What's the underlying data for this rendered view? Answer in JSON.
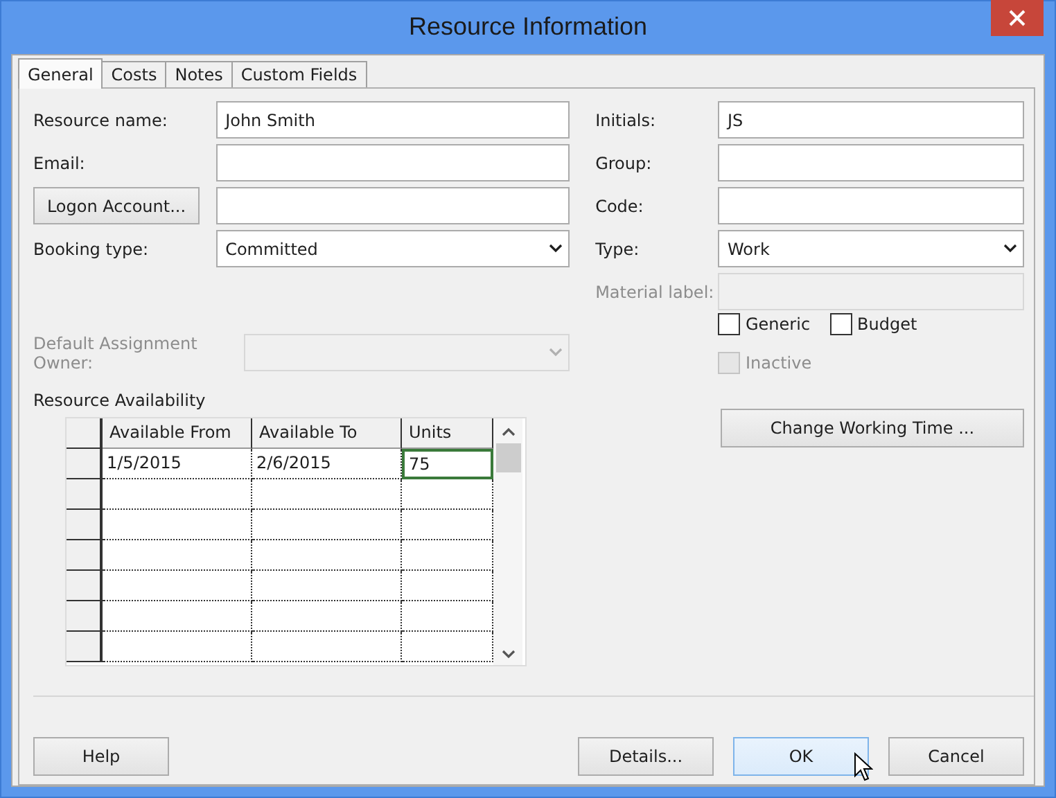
{
  "window": {
    "title": "Resource Information"
  },
  "tabs": [
    {
      "label": "General",
      "selected": true
    },
    {
      "label": "Costs",
      "selected": false
    },
    {
      "label": "Notes",
      "selected": false
    },
    {
      "label": "Custom Fields",
      "selected": false
    }
  ],
  "left_fields": [
    {
      "kind": "text",
      "label": "Resource name:",
      "value": "John Smith"
    },
    {
      "kind": "text",
      "label": "Email:"
    },
    {
      "kind": "button",
      "label": "Logon Account..."
    },
    {
      "kind": "dropdown",
      "label": "Booking type:",
      "value": "Committed"
    }
  ],
  "assignment_owner": {
    "label": "Default Assignment Owner:",
    "disabled": true
  },
  "right_fields": [
    {
      "kind": "text",
      "label": "Initials:",
      "value": "JS",
      "disabled": false
    },
    {
      "kind": "text",
      "label": "Group:",
      "disabled": false
    },
    {
      "kind": "text",
      "label": "Code:",
      "disabled": false
    },
    {
      "kind": "dropdown",
      "label": "Type:",
      "value": "Work",
      "disabled": false
    },
    {
      "kind": "text",
      "label": "Material label:",
      "disabled": true
    }
  ],
  "checkboxes": [
    {
      "label": "Generic",
      "checked": false,
      "disabled": false
    },
    {
      "label": "Budget",
      "checked": false,
      "disabled": false
    },
    {
      "label": "Inactive",
      "checked": false,
      "disabled": true
    }
  ],
  "availability": {
    "title": "Resource Availability",
    "columns": [
      "Available From",
      "Available To",
      "Units"
    ],
    "rows": [
      {
        "cells": [
          {
            "text": "1/5/2015",
            "selected": false
          },
          {
            "text": "2/6/2015",
            "selected": false
          },
          {
            "text": "75",
            "selected": true
          }
        ]
      }
    ]
  },
  "change_working_time": "Change Working Time ...",
  "buttons": [
    {
      "label": "Help",
      "default": false
    },
    {
      "label": "Details...",
      "default": false
    },
    {
      "label": "OK",
      "default": true
    },
    {
      "label": "Cancel",
      "default": false
    }
  ]
}
